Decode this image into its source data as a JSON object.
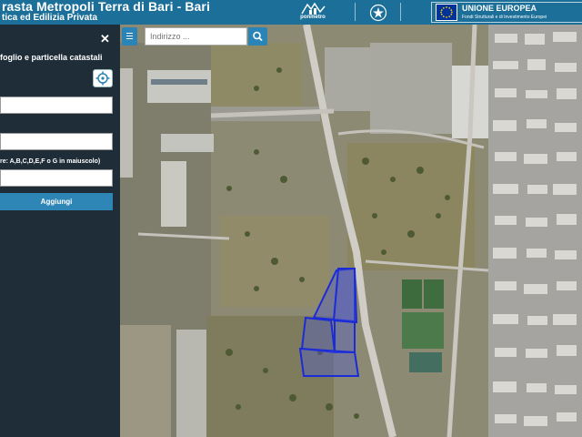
{
  "header": {
    "title": "rasta Metropoli Terra di Bari - Bari",
    "subtitle": "tica ed Edilizia Privata",
    "ponmetro_label": "ponmetro",
    "eu_title": "UNIONE EUROPEA",
    "eu_subtitle": "Fondi Strutturali e di Investimento Europei",
    "brand_color": "#1b6f98"
  },
  "panel": {
    "close_icon": "close-icon",
    "title": "foglio e particella catastali",
    "locate_icon": "crosshair-icon",
    "field1_value": "",
    "field2_value": "",
    "hint": "re: A,B,C,D,E,F o G in maiuscolo)",
    "field3_value": "",
    "add_label": "Aggiungi",
    "accent_color": "#2e86b7"
  },
  "map": {
    "menu_icon": "hamburger-icon",
    "search_placeholder": "Indirizzo ...",
    "search_icon": "search-icon",
    "parcel_color": "#1a2bd8"
  }
}
